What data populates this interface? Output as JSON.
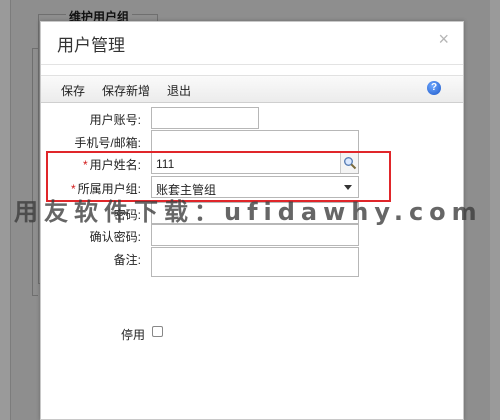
{
  "background": {
    "group_title": "维护用户组"
  },
  "dialog": {
    "title": "用户管理",
    "close_glyph": "×"
  },
  "toolbar": {
    "save_label": "保存",
    "save_new_label": "保存新增",
    "exit_label": "退出",
    "help_glyph": "?"
  },
  "form": {
    "account_label": "用户账号:",
    "account_value": "",
    "phone_email_label": "手机号/邮箱:",
    "phone_email_value": "",
    "name_label": "用户姓名:",
    "name_value": "111",
    "group_label": "所属用户组:",
    "group_value": "账套主管组",
    "password_label": "密码:",
    "confirm_password_label": "确认密码:",
    "note_label": "备注:",
    "disabled_label": "停用",
    "disabled_checked": false,
    "required_mark": "*"
  },
  "watermark": {
    "text": "用友软件下载：ufidawhy.com"
  },
  "colors": {
    "highlight": "#e0262a",
    "required": "#d21a1a",
    "help_icon": "#1d59c9"
  }
}
